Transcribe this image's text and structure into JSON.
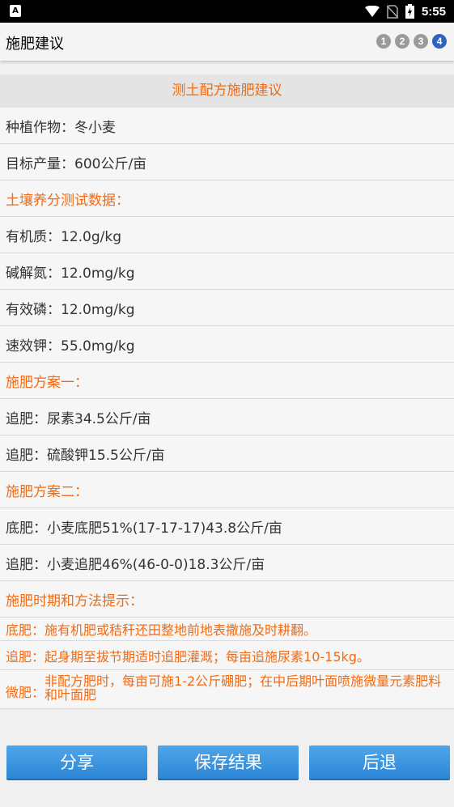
{
  "status": {
    "time": "5:55",
    "notification_icon_text": "A"
  },
  "header": {
    "title": "施肥建议",
    "steps": [
      "1",
      "2",
      "3",
      "4"
    ],
    "active_step": 4
  },
  "banner": "测土配方施肥建议",
  "rows": [
    {
      "text": "种植作物：冬小麦",
      "style": "normal"
    },
    {
      "text": "目标产量：600公斤/亩",
      "style": "normal"
    },
    {
      "text": "土壤养分测试数据：",
      "style": "orange"
    },
    {
      "text": "有机质：12.0g/kg",
      "style": "normal"
    },
    {
      "text": "碱解氮：12.0mg/kg",
      "style": "normal"
    },
    {
      "text": "有效磷：12.0mg/kg",
      "style": "normal"
    },
    {
      "text": "速效钾：55.0mg/kg",
      "style": "normal"
    },
    {
      "text": "施肥方案一：",
      "style": "orange"
    },
    {
      "text": "追肥：尿素34.5公斤/亩",
      "style": "normal"
    },
    {
      "text": "追肥：硫酸钾15.5公斤/亩",
      "style": "normal"
    },
    {
      "text": "施肥方案二：",
      "style": "orange"
    },
    {
      "text": "底肥：小麦底肥51%(17-17-17)43.8公斤/亩",
      "style": "normal"
    },
    {
      "text": "追肥：小麦追肥46%(46-0-0)18.3公斤/亩",
      "style": "normal"
    },
    {
      "text": "施肥时期和方法提示：",
      "style": "orange"
    }
  ],
  "tips": [
    {
      "label": "底肥：",
      "text": "施有机肥或秸秆还田整地前地表撒施及时耕翻。"
    },
    {
      "label": "追肥：",
      "text": "起身期至拔节期适时追肥灌溉；每亩追施尿素10-15kg。"
    },
    {
      "label": "微肥：",
      "text": "非配方肥时，每亩可施1-2公斤硼肥；在中后期叶面喷施微量元素肥料和叶面肥"
    }
  ],
  "buttons": {
    "share": "分享",
    "save": "保存结果",
    "back": "后退"
  },
  "colors": {
    "accent": "#f26b12",
    "button": "#3a93de",
    "step_active": "#2f63c2"
  }
}
